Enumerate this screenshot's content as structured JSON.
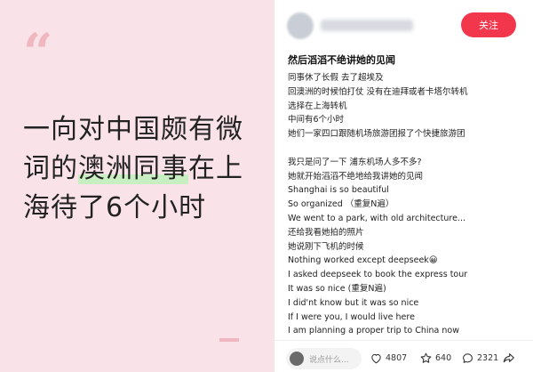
{
  "cover": {
    "quote_glyph": "“",
    "title_part1": "一向对中国颇有微词的",
    "title_highlight": "澳洲同事",
    "title_part2": "在上海待了6个小时",
    "background": "#f9e3e8",
    "accent": "#f0b7c0",
    "highlight_color": "#c7efc1"
  },
  "author": {
    "name": "",
    "follow_label": "关注",
    "follow_color": "#f2374c"
  },
  "post": {
    "title": "然后滔滔不绝讲她的见闻",
    "lines": [
      "同事休了长假 去了超埃及",
      "回澳洲的时候怕打仗 没有在迪拜或者卡塔尔转机",
      "选择在上海转机",
      "中间有6个小时",
      "她们一家四口跟随机场旅游团报了个快捷旅游团",
      "",
      "我只是问了一下 浦东机场人多不多?",
      "她就开始滔滔不绝地给我讲她的见闻",
      "Shanghai is so beautiful",
      "So organized （重复N遍）",
      "We went to a park, with old architecture...",
      "还给我看她拍的照片",
      "她说刚下飞机的时候",
      "Nothing worked except deepseek😀",
      "I asked deepseek to book the express tour",
      "It was so nice (重复N遍)",
      "I did'nt know but it was so nice",
      "If I were you, I would live here",
      "I am planning a proper trip to China now"
    ]
  },
  "footer": {
    "comment_placeholder": "说点什么...",
    "likes": "4807",
    "stars": "640",
    "comments": "2321",
    "icons": [
      "heart-icon",
      "star-icon",
      "comment-icon",
      "share-icon"
    ]
  }
}
